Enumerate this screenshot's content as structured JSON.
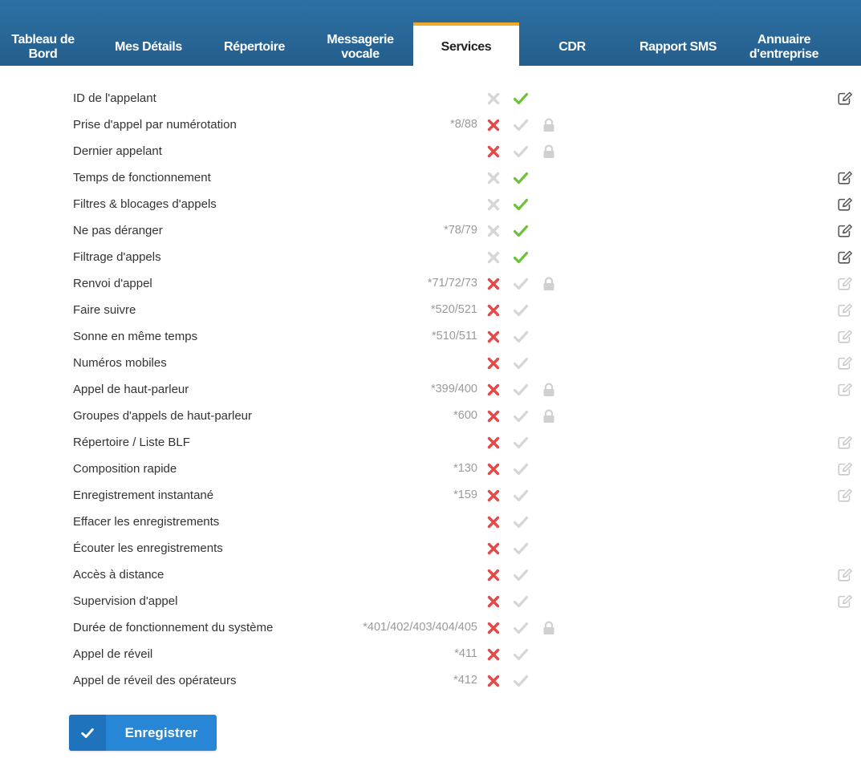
{
  "tabs": [
    {
      "line1": "Tableau de",
      "line2": "Bord",
      "active": false
    },
    {
      "line1": "Mes Détails",
      "line2": "",
      "active": false
    },
    {
      "line1": "Répertoire",
      "line2": "",
      "active": false
    },
    {
      "line1": "Messagerie",
      "line2": "vocale",
      "active": false
    },
    {
      "line1": "Services",
      "line2": "",
      "active": true
    },
    {
      "line1": "CDR",
      "line2": "",
      "active": false
    },
    {
      "line1": "Rapport SMS",
      "line2": "",
      "active": false
    },
    {
      "line1": "Annuaire",
      "line2": "d'entreprise",
      "active": false
    }
  ],
  "colors": {
    "tab_bar": "#2a6a9c",
    "active_tab_accent": "#f0a92b",
    "x_active": "#e64848",
    "x_inactive": "#d6d6d6",
    "check_active": "#6cc23a",
    "check_inactive": "#d6d6d6",
    "lock": "#d0d0d0",
    "edit_active": "#555555",
    "edit_inactive": "#c8c8c8",
    "button": "#2786d6"
  },
  "services": [
    {
      "label": "ID de l'appelant",
      "code": "",
      "enabled": true,
      "locked": false,
      "edit": "active"
    },
    {
      "label": "Prise d'appel par numérotation",
      "code": "*8/88",
      "enabled": false,
      "locked": true,
      "edit": "none"
    },
    {
      "label": "Dernier appelant",
      "code": "",
      "enabled": false,
      "locked": true,
      "edit": "none"
    },
    {
      "label": "Temps de fonctionnement",
      "code": "",
      "enabled": true,
      "locked": false,
      "edit": "active"
    },
    {
      "label": "Filtres & blocages d'appels",
      "code": "",
      "enabled": true,
      "locked": false,
      "edit": "active"
    },
    {
      "label": "Ne pas déranger",
      "code": "*78/79",
      "enabled": true,
      "locked": false,
      "edit": "active"
    },
    {
      "label": "Filtrage d'appels",
      "code": "",
      "enabled": true,
      "locked": false,
      "edit": "active"
    },
    {
      "label": "Renvoi d'appel",
      "code": "*71/72/73",
      "enabled": false,
      "locked": true,
      "edit": "inactive"
    },
    {
      "label": "Faire suivre",
      "code": "*520/521",
      "enabled": false,
      "locked": false,
      "edit": "inactive"
    },
    {
      "label": "Sonne en même temps",
      "code": "*510/511",
      "enabled": false,
      "locked": false,
      "edit": "inactive"
    },
    {
      "label": "Numéros mobiles",
      "code": "",
      "enabled": false,
      "locked": false,
      "edit": "inactive"
    },
    {
      "label": "Appel de haut-parleur",
      "code": "*399/400",
      "enabled": false,
      "locked": true,
      "edit": "inactive"
    },
    {
      "label": "Groupes d'appels de haut-parleur",
      "code": "*600",
      "enabled": false,
      "locked": true,
      "edit": "none"
    },
    {
      "label": "Répertoire / Liste BLF",
      "code": "",
      "enabled": false,
      "locked": false,
      "edit": "inactive"
    },
    {
      "label": "Composition rapide",
      "code": "*130",
      "enabled": false,
      "locked": false,
      "edit": "inactive"
    },
    {
      "label": "Enregistrement instantané",
      "code": "*159",
      "enabled": false,
      "locked": false,
      "edit": "inactive"
    },
    {
      "label": "Effacer les enregistrements",
      "code": "",
      "enabled": false,
      "locked": false,
      "edit": "none"
    },
    {
      "label": "Écouter les enregistrements",
      "code": "",
      "enabled": false,
      "locked": false,
      "edit": "none"
    },
    {
      "label": "Accès à distance",
      "code": "",
      "enabled": false,
      "locked": false,
      "edit": "inactive"
    },
    {
      "label": "Supervision d'appel",
      "code": "",
      "enabled": false,
      "locked": false,
      "edit": "inactive"
    },
    {
      "label": "Durée de fonctionnement du système",
      "code": "*401/402/403/404/405",
      "enabled": false,
      "locked": true,
      "edit": "none"
    },
    {
      "label": "Appel de réveil",
      "code": "*411",
      "enabled": false,
      "locked": false,
      "edit": "none"
    },
    {
      "label": "Appel de réveil des opérateurs",
      "code": "*412",
      "enabled": false,
      "locked": false,
      "edit": "none"
    }
  ],
  "save_button": {
    "label": "Enregistrer",
    "icon": "check-icon"
  }
}
